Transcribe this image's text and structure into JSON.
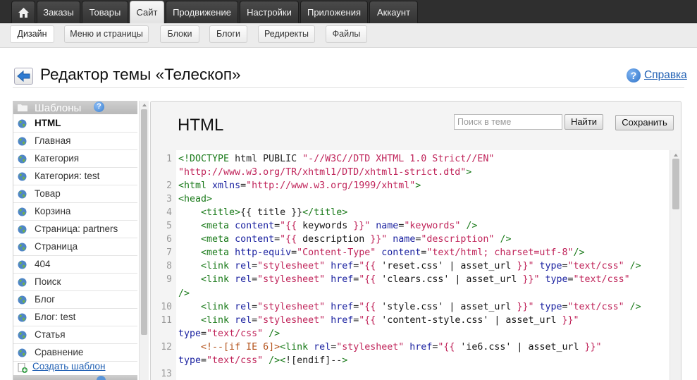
{
  "topnav": {
    "home_icon": "home-icon",
    "tabs": [
      "Заказы",
      "Товары",
      "Сайт",
      "Продвижение",
      "Настройки",
      "Приложения",
      "Аккаунт"
    ],
    "active": "Сайт"
  },
  "subnav": {
    "tabs": [
      "Дизайн",
      "Меню и страницы",
      "Блоки",
      "Блоги",
      "Редиректы",
      "Файлы"
    ],
    "active": "Дизайн"
  },
  "header": {
    "title": "Редактор темы «Телескоп»",
    "back_icon": "arrow-left-icon",
    "help_label": "Справка"
  },
  "sidebar": {
    "title": "Шаблоны",
    "items": [
      "HTML",
      "Главная",
      "Категория",
      "Категория: test",
      "Товар",
      "Корзина",
      "Страница: partners",
      "Страница",
      "404",
      "Поиск",
      "Блог",
      "Блог: test",
      "Статья",
      "Сравнение"
    ],
    "active": "HTML",
    "create_label": "Создать шаблон"
  },
  "editor": {
    "title": "HTML",
    "search_placeholder": "Поиск в теме",
    "find_label": "Найти",
    "save_label": "Сохранить",
    "line_numbers": [
      "1",
      "2",
      "3",
      "4",
      "5",
      "6",
      "7",
      "8",
      "9",
      "10",
      "11",
      "12",
      "13"
    ],
    "code_lines": [
      "<!DOCTYPE html PUBLIC \"-//W3C//DTD XHTML 1.0 Strict//EN\"",
      "\"http://www.w3.org/TR/xhtml1/DTD/xhtml1-strict.dtd\">",
      "<html xmlns=\"http://www.w3.org/1999/xhtml\">",
      "<head>",
      "    <title>{{ title }}</title>",
      "    <meta content=\"{{ keywords }}\" name=\"keywords\" />",
      "    <meta content=\"{{ description }}\" name=\"description\" />",
      "    <meta http-equiv=\"Content-Type\" content=\"text/html; charset=utf-8\"/>",
      "    <link rel=\"stylesheet\" href=\"{{ 'reset.css' | asset_url }}\" type=\"text/css\" />",
      "    <link rel=\"stylesheet\" href=\"{{ 'clears.css' | asset_url }}\" type=\"text/css\"",
      "/>",
      "    <link rel=\"stylesheet\" href=\"{{ 'style.css' | asset_url }}\" type=\"text/css\" />",
      "    <link rel=\"stylesheet\" href=\"{{ 'content-style.css' | asset_url }}\"",
      "type=\"text/css\" />",
      "    <!--[if IE 6]><link rel=\"stylesheet\" href=\"{{ 'ie6.css' | asset_url }}\"",
      "type=\"text/css\" /><![endif]-->"
    ]
  }
}
